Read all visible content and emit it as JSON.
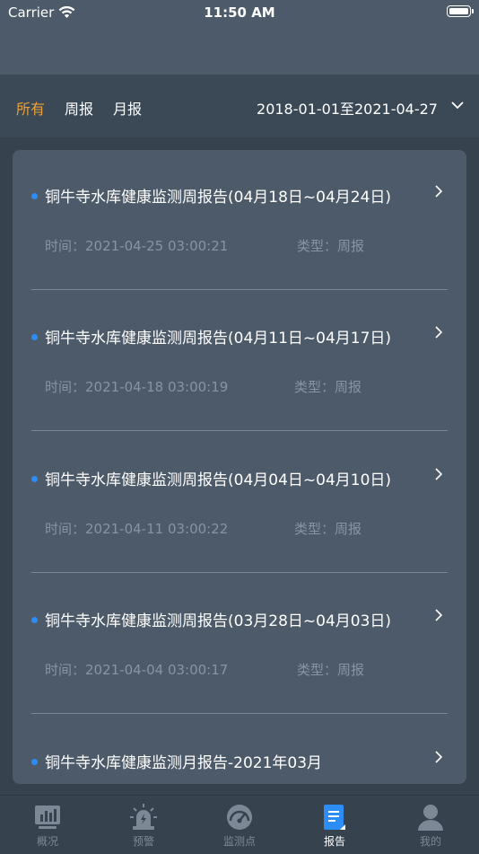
{
  "status_bar": {
    "carrier": "Carrier",
    "time": "11:50 AM"
  },
  "filters": {
    "tabs": [
      "所有",
      "周报",
      "月报"
    ],
    "active_index": 0,
    "date_range": "2018-01-01至2021-04-27"
  },
  "reports": [
    {
      "title": "铜牛寺水库健康监测周报告(04月18日~04月24日)",
      "time": "时间：2021-04-25 03:00:21",
      "type": "类型：周报"
    },
    {
      "title": "铜牛寺水库健康监测周报告(04月11日~04月17日)",
      "time": "时间：2021-04-18 03:00:19",
      "type": "类型：周报"
    },
    {
      "title": "铜牛寺水库健康监测周报告(04月04日~04月10日)",
      "time": "时间：2021-04-11 03:00:22",
      "type": "类型：周报"
    },
    {
      "title": "铜牛寺水库健康监测周报告(03月28日~04月03日)",
      "time": "时间：2021-04-04 03:00:17",
      "type": "类型：周报"
    },
    {
      "title": "铜牛寺水库健康监测月报告-2021年03月"
    }
  ],
  "tabbar": {
    "items": [
      {
        "label": "概况",
        "icon": "overview-chart-icon"
      },
      {
        "label": "预警",
        "icon": "alarm-light-icon"
      },
      {
        "label": "监测点",
        "icon": "gauge-icon"
      },
      {
        "label": "报告",
        "icon": "report-doc-icon"
      },
      {
        "label": "我的",
        "icon": "person-icon"
      }
    ],
    "active_index": 3
  },
  "colors": {
    "accent": "#e9a13b",
    "dot": "#2b8df5",
    "report_active": "#2b8df5"
  }
}
